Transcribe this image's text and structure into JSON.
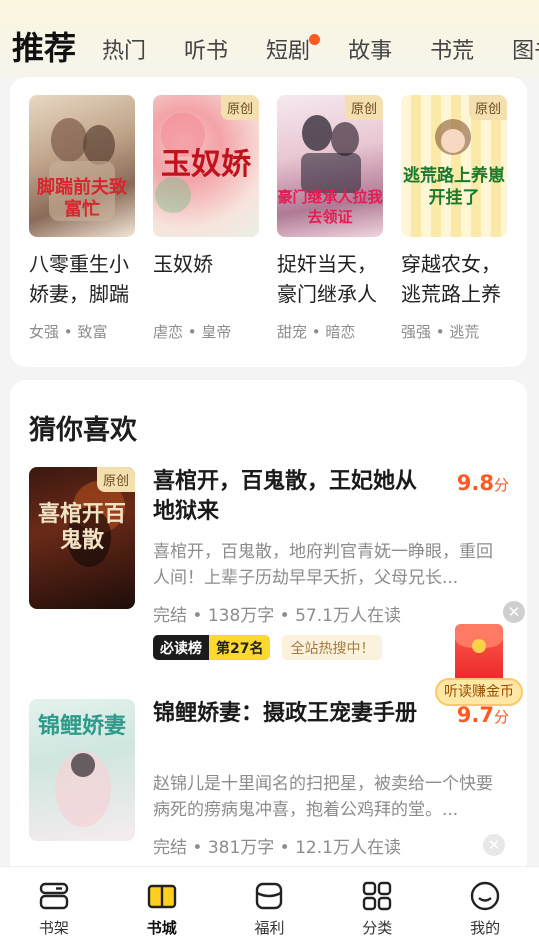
{
  "tabs": [
    {
      "label": "推荐",
      "active": true
    },
    {
      "label": "热门"
    },
    {
      "label": "听书"
    },
    {
      "label": "短剧",
      "has_dot": true
    },
    {
      "label": "故事"
    },
    {
      "label": "书荒"
    },
    {
      "label": "图书"
    }
  ],
  "recommend": {
    "books": [
      {
        "title": "八零重生小娇妻，脚踹",
        "tags": "女强 • 致富",
        "cover_text": "脚踹前夫致富忙",
        "badge": ""
      },
      {
        "title": "玉奴娇",
        "tags": "虐恋 • 皇帝",
        "cover_text": "玉奴娇",
        "badge": "原创"
      },
      {
        "title": "捉奸当天，豪门继承人",
        "tags": "甜宠 • 暗恋",
        "cover_text": "豪门继承人拉我去领证",
        "badge": "原创"
      },
      {
        "title": "穿越农女，逃荒路上养",
        "tags": "强强 • 逃荒",
        "cover_text": "逃荒路上养崽开挂了",
        "badge": "原创"
      }
    ]
  },
  "guess": {
    "heading": "猜你喜欢",
    "books": [
      {
        "title": "喜棺开，百鬼散，王妃她从地狱来",
        "score": "9.8",
        "score_unit": "分",
        "desc": "喜棺开，百鬼散，地府判官青妩一睁眼，重回人间！上辈子历劫早早夭折，父母兄长...",
        "meta": "完结 • 138万字 • 57.1万人在读",
        "rank_label": "必读榜",
        "rank_value": "第27名",
        "hot_label": "全站热搜中！",
        "badge": "原创",
        "cover_text": "喜棺开百鬼散"
      },
      {
        "title": "锦鲤娇妻：摄政王宠妻手册",
        "score": "9.7",
        "score_unit": "分",
        "desc": "赵锦儿是十里闻名的扫把星，被卖给一个快要病死的痨病鬼冲喜，抱着公鸡拜的堂。...",
        "meta": "完结 • 381万字 • 12.1万人在读",
        "badge": "",
        "cover_text": "锦鲤娇妻"
      }
    ]
  },
  "floating": {
    "earn_label": "听读赚金币"
  },
  "nav": [
    {
      "label": "书架",
      "icon": "bookshelf-icon"
    },
    {
      "label": "书城",
      "icon": "bookstore-icon",
      "active": true
    },
    {
      "label": "福利",
      "icon": "welfare-icon"
    },
    {
      "label": "分类",
      "icon": "category-icon"
    },
    {
      "label": "我的",
      "icon": "profile-icon"
    }
  ],
  "colors": {
    "accent": "#ffd400",
    "score": "#ff5a26",
    "tab_dot": "#ff5a1f"
  }
}
